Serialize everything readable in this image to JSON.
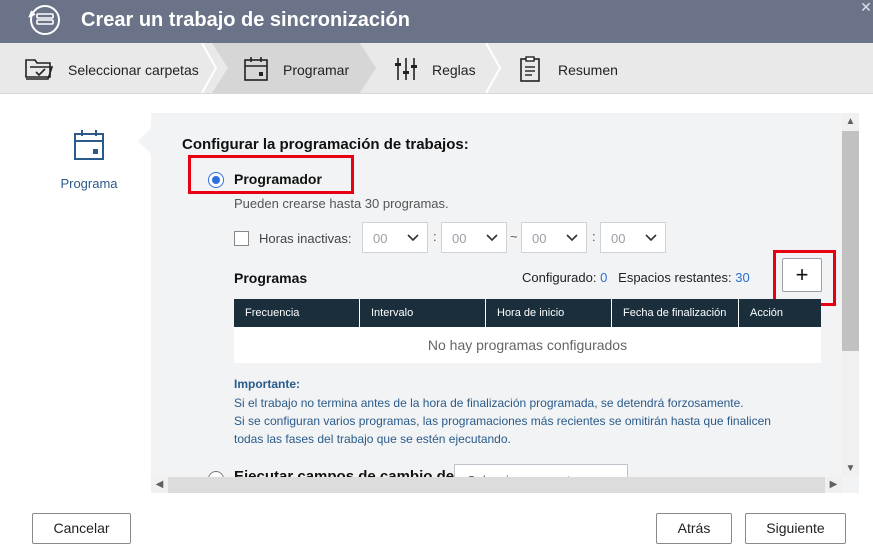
{
  "window": {
    "title": "Crear un trabajo de sincronización",
    "close_icon": "close-icon"
  },
  "steps": [
    {
      "label": "Seleccionar carpetas",
      "icon": "folder-select-icon",
      "active": false
    },
    {
      "label": "Programar",
      "icon": "calendar-icon",
      "active": true
    },
    {
      "label": "Reglas",
      "icon": "sliders-icon",
      "active": false
    },
    {
      "label": "Resumen",
      "icon": "clipboard-icon",
      "active": false
    }
  ],
  "leftnav": {
    "label": "Programa",
    "icon": "calendar-icon"
  },
  "main": {
    "section_title": "Configurar la programación de trabajos:",
    "scheduler": {
      "label": "Programador",
      "selected": true,
      "hint": "Pueden crearse hasta 30 programas."
    },
    "inactive_hours": {
      "label": "Horas inactivas:",
      "checked": false,
      "start_hour": "00",
      "start_min": "00",
      "end_hour": "00",
      "end_min": "00",
      "colon": ":",
      "tilde": "~"
    },
    "programs": {
      "title": "Programas",
      "configured_label": "Configurado:",
      "configured_value": "0",
      "remaining_label": "Espacios restantes:",
      "remaining_value": "30",
      "add_label": "+"
    },
    "table": {
      "columns": [
        "Frecuencia",
        "Intervalo",
        "Hora de inicio",
        "Fecha de finalización",
        "Acción"
      ],
      "empty_text": "No hay programas configurados"
    },
    "important": {
      "title": "Importante:",
      "lines": [
        "Si el trabajo no termina antes de la hora de finalización programada, se detendrá forzosamente.",
        "Si se configuran varios programas, las programaciones más recientes se omitirán hasta que finalicen",
        "todas las fases del trabajo que se estén ejecutando."
      ]
    },
    "second_option": {
      "label": "Ejecutar campos de cambio de...",
      "select_value": "Seleccionar evento"
    }
  },
  "footer": {
    "cancel": "Cancelar",
    "back": "Atrás",
    "next": "Siguiente"
  },
  "colors": {
    "titlebar": "#6b7389",
    "accent_blue": "#2f6fdc",
    "highlight_red": "#e60012",
    "table_header": "#1a2e3b",
    "info_text": "#2a5b8a"
  }
}
